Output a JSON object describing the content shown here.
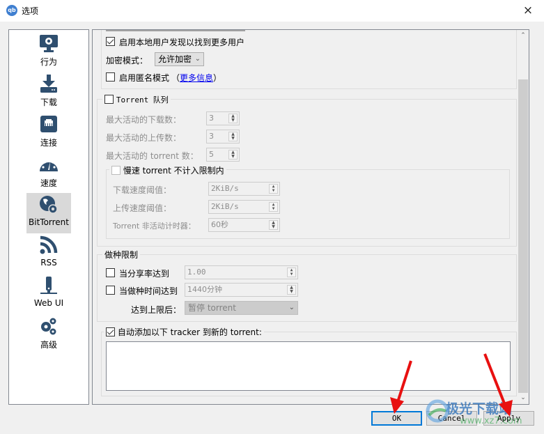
{
  "window": {
    "title": "选项",
    "app_icon": "qb",
    "close_icon": "×"
  },
  "sidebar": {
    "items": [
      {
        "label": "行为",
        "icon": "monitor-gear-icon"
      },
      {
        "label": "下载",
        "icon": "download-icon"
      },
      {
        "label": "连接",
        "icon": "network-port-icon"
      },
      {
        "label": "速度",
        "icon": "speedometer-icon"
      },
      {
        "label": "BitTorrent",
        "icon": "globe-gear-icon",
        "active": true
      },
      {
        "label": "RSS",
        "icon": "rss-icon"
      },
      {
        "label": "Web UI",
        "icon": "web-ui-icon"
      },
      {
        "label": "高级",
        "icon": "gears-icon"
      }
    ]
  },
  "privacy": {
    "local_peer_discovery": {
      "label": "启用本地用户发现以找到更多用户",
      "checked": true
    },
    "encryption_label": "加密模式：",
    "encryption_value": "允许加密",
    "anonymous_mode": {
      "label": "启用匿名模式",
      "checked": false
    },
    "more_info_open": "（",
    "more_info_link": "更多信息",
    "more_info_close": "）"
  },
  "queue": {
    "title": "Torrent 队列",
    "checked": false,
    "max_downloads_label": "最大活动的下载数：",
    "max_downloads_value": "3",
    "max_uploads_label": "最大活动的上传数：",
    "max_uploads_value": "3",
    "max_torrents_label": "最大活动的 torrent 数：",
    "max_torrents_value": "5",
    "slow": {
      "title": "慢速 torrent 不计入限制内",
      "checked": false,
      "dl_threshold_label": "下载速度阈值：",
      "dl_threshold_value": "2KiB/s",
      "ul_threshold_label": "上传速度阈值：",
      "ul_threshold_value": "2KiB/s",
      "inactive_timer_label": "Torrent 非活动计时器：",
      "inactive_timer_value": "60秒"
    }
  },
  "seeding": {
    "title": "做种限制",
    "ratio": {
      "label": "当分享率达到",
      "checked": false,
      "value": "1.00"
    },
    "time": {
      "label": "当做种时间达到",
      "checked": false,
      "value": "1440分钟"
    },
    "action_label": "达到上限后：",
    "action_value": "暂停 torrent"
  },
  "trackers": {
    "label": "自动添加以下 tracker 到新的 torrent:",
    "checked": true,
    "value": ""
  },
  "buttons": {
    "ok": "OK",
    "cancel": "Cancel",
    "apply": "Apply"
  },
  "watermark": {
    "text": "极光下载站",
    "url_text": "www.xz7.com"
  },
  "colors": {
    "accent": "#0078d7",
    "icon": "#2f4f6f",
    "arrow": "#e81010"
  }
}
